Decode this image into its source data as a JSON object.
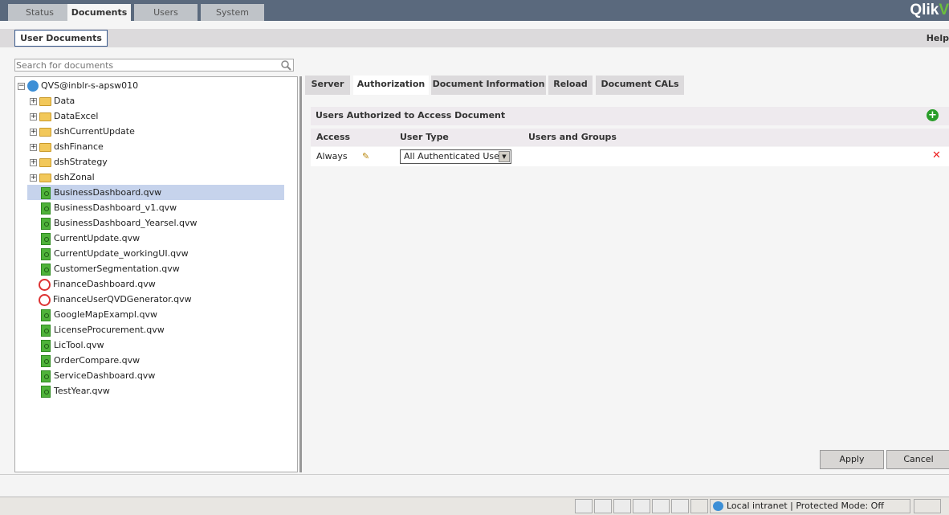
{
  "top_tabs": [
    {
      "label": "Status"
    },
    {
      "label": "Documents",
      "active": true
    },
    {
      "label": "Users"
    },
    {
      "label": "System"
    }
  ],
  "logo": {
    "text1": "Qlik",
    "text2": "V"
  },
  "subnav": {
    "user_documents": "User Documents",
    "help": "Help"
  },
  "search": {
    "placeholder": "Search for documents"
  },
  "tree": {
    "root": "QVS@inblr-s-apsw010",
    "folders": [
      "Data",
      "DataExcel",
      "dshCurrentUpdate",
      "dshFinance",
      "dshStrategy",
      "dshZonal"
    ],
    "files": [
      {
        "name": "BusinessDashboard.qvw",
        "icon": "qvw",
        "selected": true
      },
      {
        "name": "BusinessDashboard_v1.qvw",
        "icon": "qvw"
      },
      {
        "name": "BusinessDashboard_Yearsel.qvw",
        "icon": "qvw"
      },
      {
        "name": "CurrentUpdate.qvw",
        "icon": "qvw"
      },
      {
        "name": "CurrentUpdate_workingUI.qvw",
        "icon": "qvw"
      },
      {
        "name": "CustomerSegmentation.qvw",
        "icon": "qvw"
      },
      {
        "name": "FinanceDashboard.qvw",
        "icon": "scheduled"
      },
      {
        "name": "FinanceUserQVDGenerator.qvw",
        "icon": "scheduled"
      },
      {
        "name": "GoogleMapExampl.qvw",
        "icon": "qvw"
      },
      {
        "name": "LicenseProcurement.qvw",
        "icon": "qvw"
      },
      {
        "name": "LicTool.qvw",
        "icon": "qvw"
      },
      {
        "name": "OrderCompare.qvw",
        "icon": "qvw"
      },
      {
        "name": "ServiceDashboard.qvw",
        "icon": "qvw"
      },
      {
        "name": "TestYear.qvw",
        "icon": "qvw"
      }
    ]
  },
  "doc_tabs": [
    {
      "label": "Server"
    },
    {
      "label": "Authorization",
      "active": true
    },
    {
      "label": "Document Information"
    },
    {
      "label": "Reload"
    },
    {
      "label": "Document CALs"
    }
  ],
  "authorization": {
    "section_title": "Users Authorized to Access Document",
    "columns": [
      "Access",
      "User Type",
      "Users and Groups"
    ],
    "rows": [
      {
        "access": "Always",
        "user_type": "All Authenticated Users",
        "users_and_groups": ""
      }
    ]
  },
  "buttons": {
    "apply": "Apply",
    "cancel": "Cancel"
  },
  "statusbar": {
    "zone": "Local intranet | Protected Mode: Off"
  },
  "colors": {
    "topbar": "#5a697d",
    "selected_row": "#c6d3ec",
    "accent_green": "#6cbf3c"
  }
}
